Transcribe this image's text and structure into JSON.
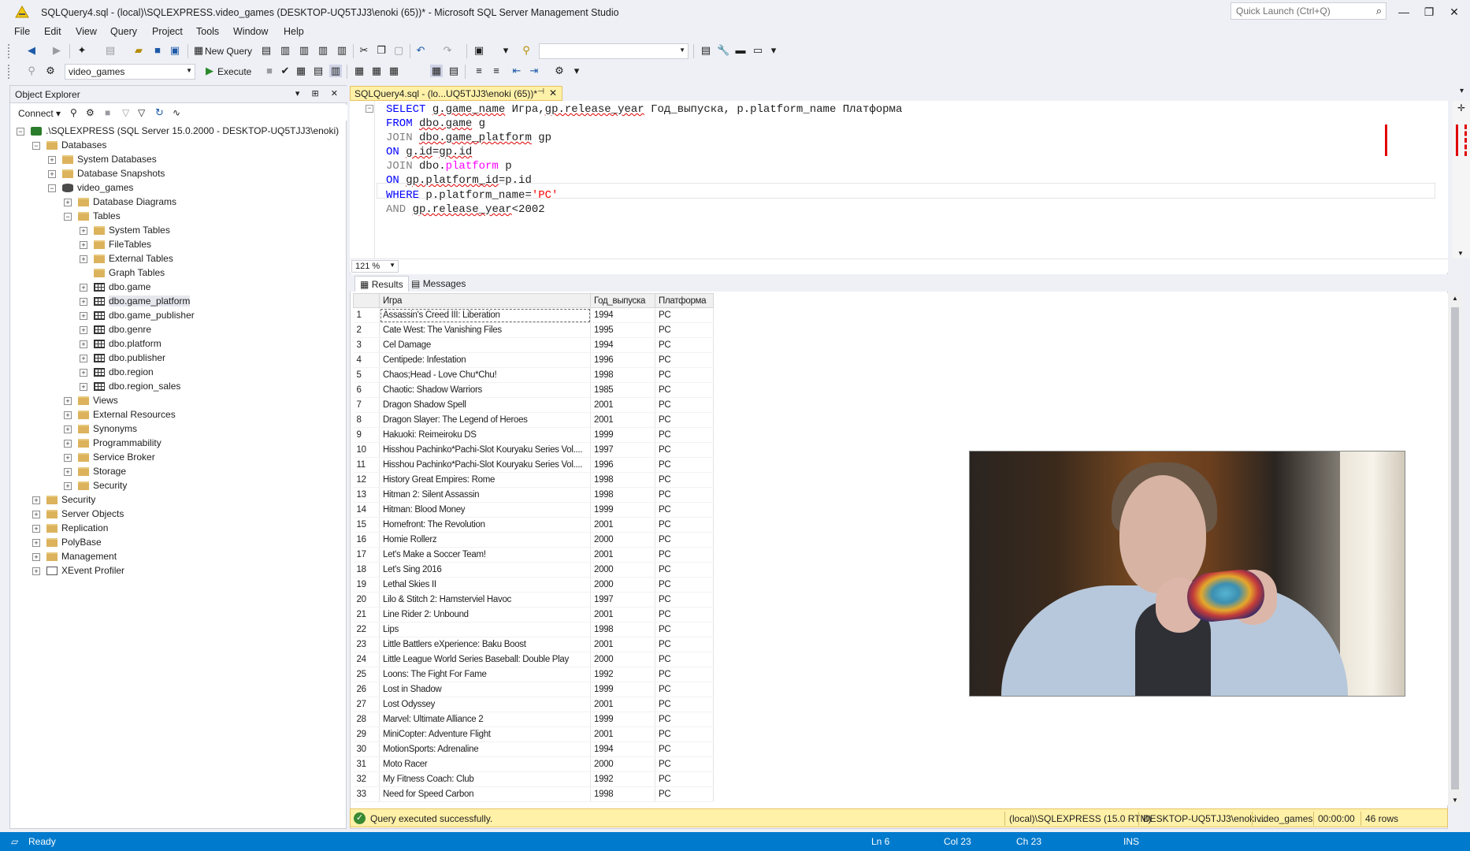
{
  "window": {
    "title": "SQLQuery4.sql - (local)\\SQLEXPRESS.video_games (DESKTOP-UQ5TJJ3\\enoki (65))* - Microsoft SQL Server Management Studio",
    "quick_launch_placeholder": "Quick Launch (Ctrl+Q)"
  },
  "menu": [
    "File",
    "Edit",
    "View",
    "Query",
    "Project",
    "Tools",
    "Window",
    "Help"
  ],
  "toolbar": {
    "new_query": "New Query",
    "database": "video_games",
    "execute": "Execute"
  },
  "object_explorer": {
    "title": "Object Explorer",
    "connect": "Connect",
    "nodes": [
      {
        "label": ".\\SQLEXPRESS (SQL Server 15.0.2000 - DESKTOP-UQ5TJJ3\\enoki)",
        "icon": "server-icon"
      },
      {
        "label": "Databases",
        "icon": "folder-icon"
      },
      {
        "label": "System Databases",
        "icon": "folder-icon"
      },
      {
        "label": "Database Snapshots",
        "icon": "folder-icon"
      },
      {
        "label": "video_games",
        "icon": "database-icon"
      },
      {
        "label": "Database Diagrams",
        "icon": "folder-icon"
      },
      {
        "label": "Tables",
        "icon": "folder-icon"
      },
      {
        "label": "System Tables",
        "icon": "folder-icon"
      },
      {
        "label": "FileTables",
        "icon": "folder-icon"
      },
      {
        "label": "External Tables",
        "icon": "folder-icon"
      },
      {
        "label": "Graph Tables",
        "icon": "folder-icon"
      },
      {
        "label": "dbo.game",
        "icon": "table-icon"
      },
      {
        "label": "dbo.game_platform",
        "icon": "table-icon"
      },
      {
        "label": "dbo.game_publisher",
        "icon": "table-icon"
      },
      {
        "label": "dbo.genre",
        "icon": "table-icon"
      },
      {
        "label": "dbo.platform",
        "icon": "table-icon"
      },
      {
        "label": "dbo.publisher",
        "icon": "table-icon"
      },
      {
        "label": "dbo.region",
        "icon": "table-icon"
      },
      {
        "label": "dbo.region_sales",
        "icon": "table-icon"
      },
      {
        "label": "Views",
        "icon": "folder-icon"
      },
      {
        "label": "External Resources",
        "icon": "folder-icon"
      },
      {
        "label": "Synonyms",
        "icon": "folder-icon"
      },
      {
        "label": "Programmability",
        "icon": "folder-icon"
      },
      {
        "label": "Service Broker",
        "icon": "folder-icon"
      },
      {
        "label": "Storage",
        "icon": "folder-icon"
      },
      {
        "label": "Security",
        "icon": "folder-icon"
      },
      {
        "label": "Security",
        "icon": "folder-icon"
      },
      {
        "label": "Server Objects",
        "icon": "folder-icon"
      },
      {
        "label": "Replication",
        "icon": "folder-icon"
      },
      {
        "label": "PolyBase",
        "icon": "folder-icon"
      },
      {
        "label": "Management",
        "icon": "folder-icon"
      },
      {
        "label": "XEvent Profiler",
        "icon": "xevent-icon"
      }
    ]
  },
  "editor_tab": "SQLQuery4.sql - (lo...UQ5TJJ3\\enoki (65))*",
  "sql_lines": [
    "SELECT g.game_name Игра,gp.release_year Год_выпуска, p.platform_name Платформа",
    "FROM dbo.game g",
    "JOIN dbo.game_platform gp",
    "ON g.id=gp.id",
    "JOIN dbo.platform p",
    "ON gp.platform_id=p.id",
    "WHERE p.platform_name='PC'",
    "AND gp.release_year<2002"
  ],
  "zoom": "121 %",
  "result_tabs": [
    "Results",
    "Messages"
  ],
  "grid": {
    "columns": [
      "Игра",
      "Год_выпуска",
      "Платформа"
    ],
    "rows": [
      [
        "1",
        "Assassin's Creed III: Liberation",
        "1994",
        "PC"
      ],
      [
        "2",
        "Cate West: The Vanishing Files",
        "1995",
        "PC"
      ],
      [
        "3",
        "Cel Damage",
        "1994",
        "PC"
      ],
      [
        "4",
        "Centipede: Infestation",
        "1996",
        "PC"
      ],
      [
        "5",
        "Chaos;Head - Love Chu*Chu!",
        "1998",
        "PC"
      ],
      [
        "6",
        "Chaotic: Shadow Warriors",
        "1985",
        "PC"
      ],
      [
        "7",
        "Dragon Shadow Spell",
        "2001",
        "PC"
      ],
      [
        "8",
        "Dragon Slayer: The Legend of Heroes",
        "2001",
        "PC"
      ],
      [
        "9",
        "Hakuoki: Reimeiroku DS",
        "1999",
        "PC"
      ],
      [
        "10",
        "Hisshou Pachinko*Pachi-Slot Kouryaku Series Vol....",
        "1997",
        "PC"
      ],
      [
        "11",
        "Hisshou Pachinko*Pachi-Slot Kouryaku Series Vol....",
        "1996",
        "PC"
      ],
      [
        "12",
        "History Great Empires: Rome",
        "1998",
        "PC"
      ],
      [
        "13",
        "Hitman 2: Silent Assassin",
        "1998",
        "PC"
      ],
      [
        "14",
        "Hitman: Blood Money",
        "1999",
        "PC"
      ],
      [
        "15",
        "Homefront: The Revolution",
        "2001",
        "PC"
      ],
      [
        "16",
        "Homie Rollerz",
        "2000",
        "PC"
      ],
      [
        "17",
        "Let's Make a Soccer Team!",
        "2001",
        "PC"
      ],
      [
        "18",
        "Let's Sing 2016",
        "2000",
        "PC"
      ],
      [
        "19",
        "Lethal Skies II",
        "2000",
        "PC"
      ],
      [
        "20",
        "Lilo & Stitch 2: Hamsterviel Havoc",
        "1997",
        "PC"
      ],
      [
        "21",
        "Line Rider 2: Unbound",
        "2001",
        "PC"
      ],
      [
        "22",
        "Lips",
        "1998",
        "PC"
      ],
      [
        "23",
        "Little Battlers eXperience: Baku Boost",
        "2001",
        "PC"
      ],
      [
        "24",
        "Little League World Series Baseball: Double Play",
        "2000",
        "PC"
      ],
      [
        "25",
        "Loons: The Fight For Fame",
        "1992",
        "PC"
      ],
      [
        "26",
        "Lost in Shadow",
        "1999",
        "PC"
      ],
      [
        "27",
        "Lost Odyssey",
        "2001",
        "PC"
      ],
      [
        "28",
        "Marvel: Ultimate Alliance 2",
        "1999",
        "PC"
      ],
      [
        "29",
        "MiniCopter: Adventure Flight",
        "2001",
        "PC"
      ],
      [
        "30",
        "MotionSports: Adrenaline",
        "1994",
        "PC"
      ],
      [
        "31",
        "Moto Racer",
        "2000",
        "PC"
      ],
      [
        "32",
        "My Fitness Coach: Club",
        "1992",
        "PC"
      ],
      [
        "33",
        "Need for Speed Carbon",
        "1998",
        "PC"
      ]
    ]
  },
  "query_status": {
    "message": "Query executed successfully.",
    "server": "(local)\\SQLEXPRESS (15.0 RTM)",
    "user": "DESKTOP-UQ5TJJ3\\enoki ...",
    "database": "video_games",
    "time": "00:00:00",
    "rows": "46 rows"
  },
  "statusbar": {
    "ready": "Ready",
    "ln": "Ln 6",
    "col": "Col 23",
    "ch": "Ch 23",
    "ins": "INS"
  },
  "colors": {
    "accent": "#007acc",
    "tab_yellow": "#fff1a8",
    "keyword": "#0000ff",
    "string": "#ff0000"
  }
}
